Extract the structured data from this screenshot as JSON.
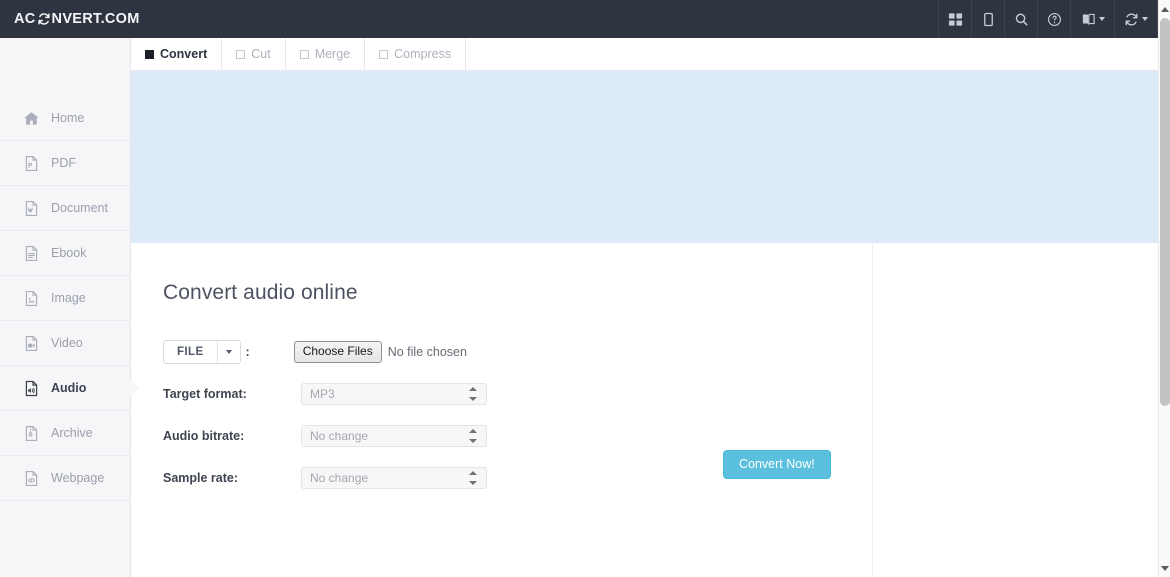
{
  "navbar": {
    "brand_prefix": "AC",
    "brand_mark": "convert-refresh-icon",
    "brand_suffix": "NVERT.COM",
    "icons": [
      {
        "name": "grid-apps-icon",
        "title": "Tools"
      },
      {
        "name": "mobile-device-icon",
        "title": "Mobile"
      },
      {
        "name": "search-icon",
        "title": "Search"
      },
      {
        "name": "help-circle-icon",
        "title": "Help"
      },
      {
        "name": "language-book-icon",
        "title": "Language"
      },
      {
        "name": "refresh-convert-icon",
        "title": "Convert"
      }
    ]
  },
  "sidebar": {
    "items": [
      {
        "label": "Home",
        "icon": "home-icon",
        "active": false
      },
      {
        "label": "PDF",
        "icon": "pdf-file-icon",
        "active": false
      },
      {
        "label": "Document",
        "icon": "word-document-icon",
        "active": false
      },
      {
        "label": "Ebook",
        "icon": "ebook-file-icon",
        "active": false
      },
      {
        "label": "Image",
        "icon": "image-file-icon",
        "active": false
      },
      {
        "label": "Video",
        "icon": "video-file-icon",
        "active": false
      },
      {
        "label": "Audio",
        "icon": "audio-file-icon",
        "active": true
      },
      {
        "label": "Archive",
        "icon": "archive-file-icon",
        "active": false
      },
      {
        "label": "Webpage",
        "icon": "webpage-code-icon",
        "active": false
      }
    ]
  },
  "tabs": [
    {
      "label": "Convert",
      "active": true
    },
    {
      "label": "Cut",
      "active": false
    },
    {
      "label": "Merge",
      "active": false
    },
    {
      "label": "Compress",
      "active": false
    }
  ],
  "main": {
    "title": "Convert audio online",
    "source_button": {
      "label": "FILE",
      "caret": "chevron-down-icon"
    },
    "separator": ":",
    "file_input": {
      "button_label": "Choose Files",
      "status_text": "No file chosen"
    },
    "fields": [
      {
        "label": "Target format:",
        "value": "MP3"
      },
      {
        "label": "Audio bitrate:",
        "value": "No change"
      },
      {
        "label": "Sample rate:",
        "value": "No change"
      }
    ],
    "submit_label": "Convert Now!"
  },
  "colors": {
    "navbar_bg": "#2e3440",
    "banner_bg": "#dcebf7",
    "sidebar_bg": "#f6f6f8",
    "accent_button": "#5bc0de",
    "active_text": "#3c4250",
    "muted_text": "#9aa0ad"
  }
}
